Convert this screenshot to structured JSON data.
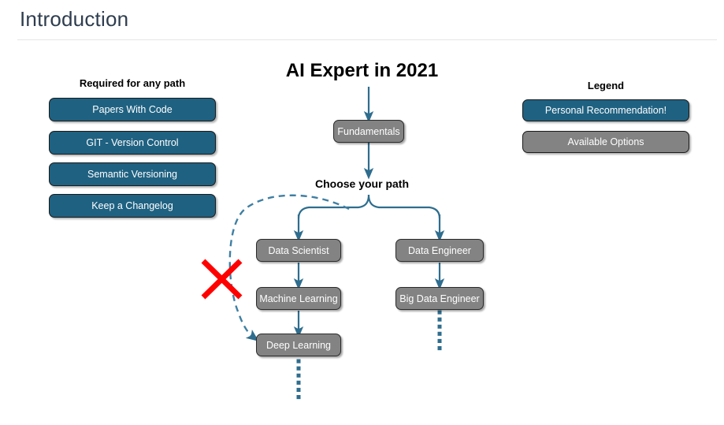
{
  "header": {
    "title": "Introduction"
  },
  "left_panel": {
    "heading": "Required for any path",
    "items": [
      {
        "label": "Papers With Code"
      },
      {
        "label": "GIT - Version Control"
      },
      {
        "label": "Semantic Versioning"
      },
      {
        "label": "Keep a Changelog"
      }
    ]
  },
  "legend": {
    "heading": "Legend",
    "items": [
      {
        "label": "Personal Recommendation!",
        "color": "#1f6181"
      },
      {
        "label": "Available Options",
        "color": "#838383"
      }
    ]
  },
  "chart_data": {
    "type": "diagram",
    "title": "AI Expert in 2021",
    "branch_label": "Choose your path",
    "root": {
      "label": "Fundamentals"
    },
    "branches": [
      {
        "name": "data-scientist-path",
        "nodes": [
          {
            "label": "Data Scientist"
          },
          {
            "label": "Machine Learning"
          },
          {
            "label": "Deep Learning"
          }
        ],
        "continues": true
      },
      {
        "name": "data-engineer-path",
        "nodes": [
          {
            "label": "Data Engineer"
          },
          {
            "label": "Big Data Engineer"
          }
        ],
        "continues": true
      }
    ],
    "shortcut": {
      "name": "skip-to-deep-learning",
      "style": "dashed",
      "from": "Choose your path",
      "to": "Deep Learning",
      "crossed_out": true,
      "cross_color": "#ff0000"
    },
    "colors": {
      "connector": "#2e6d8e",
      "node_fill": "#838383",
      "recommended_fill": "#1f6181",
      "title_text": "#000000",
      "header_text": "#2e3d4f"
    }
  }
}
